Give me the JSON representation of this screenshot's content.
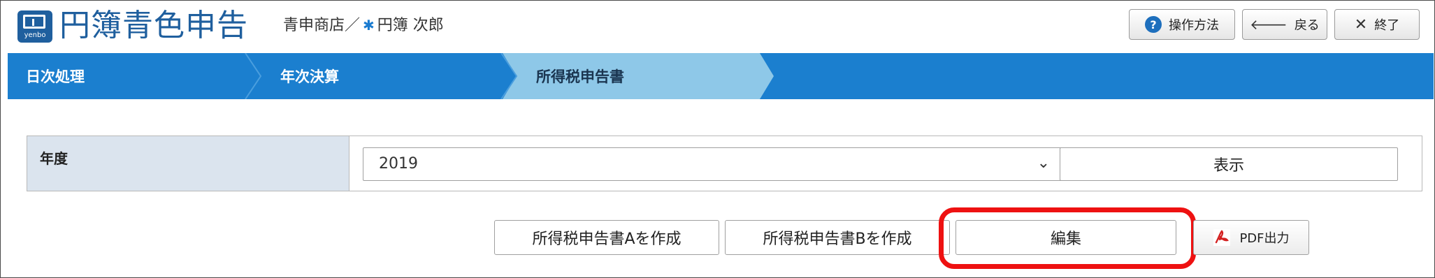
{
  "header": {
    "app_title": "円簿青色申告",
    "logo_caption": "yenbo",
    "store": "青申商店／",
    "star": "✱",
    "user": "円簿 次郎",
    "buttons": {
      "help": "操作方法",
      "back": "戻る",
      "exit": "終了"
    }
  },
  "tabs": [
    {
      "label": "日次処理",
      "active": false
    },
    {
      "label": "年次決算",
      "active": false
    },
    {
      "label": "所得税申告書",
      "active": true
    }
  ],
  "form": {
    "year_label": "年度",
    "year_value": "2019",
    "show_button": "表示"
  },
  "actions": {
    "create_a": "所得税申告書Aを作成",
    "create_b": "所得税申告書Bを作成",
    "edit": "編集",
    "pdf": "PDF出力"
  },
  "colors": {
    "brand": "#1f5f9e",
    "tab_bar": "#1b7fcf",
    "tab_active": "#8ec8e8",
    "highlight": "#ee1111",
    "label_bg": "#dbe4ee"
  }
}
